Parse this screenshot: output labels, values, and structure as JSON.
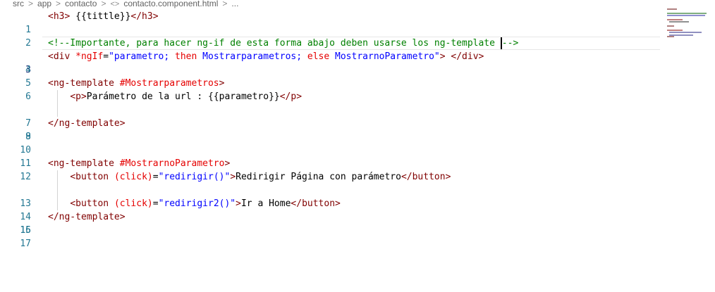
{
  "breadcrumb": {
    "items": [
      "src",
      "app",
      "contacto",
      "contacto.component.html",
      "..."
    ],
    "separator": ">",
    "file_icon": "<>"
  },
  "editor": {
    "lines": [
      {
        "n": "1",
        "text": "<h3> {{tittle}}</h3>"
      },
      {
        "n": "2",
        "text": ""
      },
      {
        "n": "3",
        "text": "<!--Importante, para hacer ng-if de esta forma abajo deben usarse los ng-template -->"
      },
      {
        "n": "4",
        "text": "<div *ngIf=\"parametro; then Mostrarparametros; else MostrarnoParametro\"> </div>"
      },
      {
        "n": "5",
        "text": ""
      },
      {
        "n": "6",
        "text": "<ng-template #Mostrarparametros>"
      },
      {
        "n": "7",
        "text": "    <p>Parámetro de la url : {{parametro}}</p>"
      },
      {
        "n": "8",
        "text": ""
      },
      {
        "n": "9",
        "text": "</ng-template>"
      },
      {
        "n": "10",
        "text": ""
      },
      {
        "n": "11",
        "text": ""
      },
      {
        "n": "12",
        "text": "<ng-template #MostrarnoParametro>"
      },
      {
        "n": "13",
        "text": "    <button (click)=\"redirigir()\">Redirigir Página con parámetro</button>"
      },
      {
        "n": "14",
        "text": ""
      },
      {
        "n": "15",
        "text": "    <button (click)=\"redirigir2()\">Ir a Home</button>"
      },
      {
        "n": "16",
        "text": "</ng-template>"
      },
      {
        "n": "17",
        "text": ""
      }
    ],
    "active_line": "3"
  },
  "colors": {
    "tag": "#800000",
    "attribute": "#e50000",
    "attribute_value": "#0000ff",
    "comment": "#008000",
    "line_number": "#237893",
    "active_line_number": "#0b216f"
  },
  "minimap": {
    "icon": "minimap"
  }
}
